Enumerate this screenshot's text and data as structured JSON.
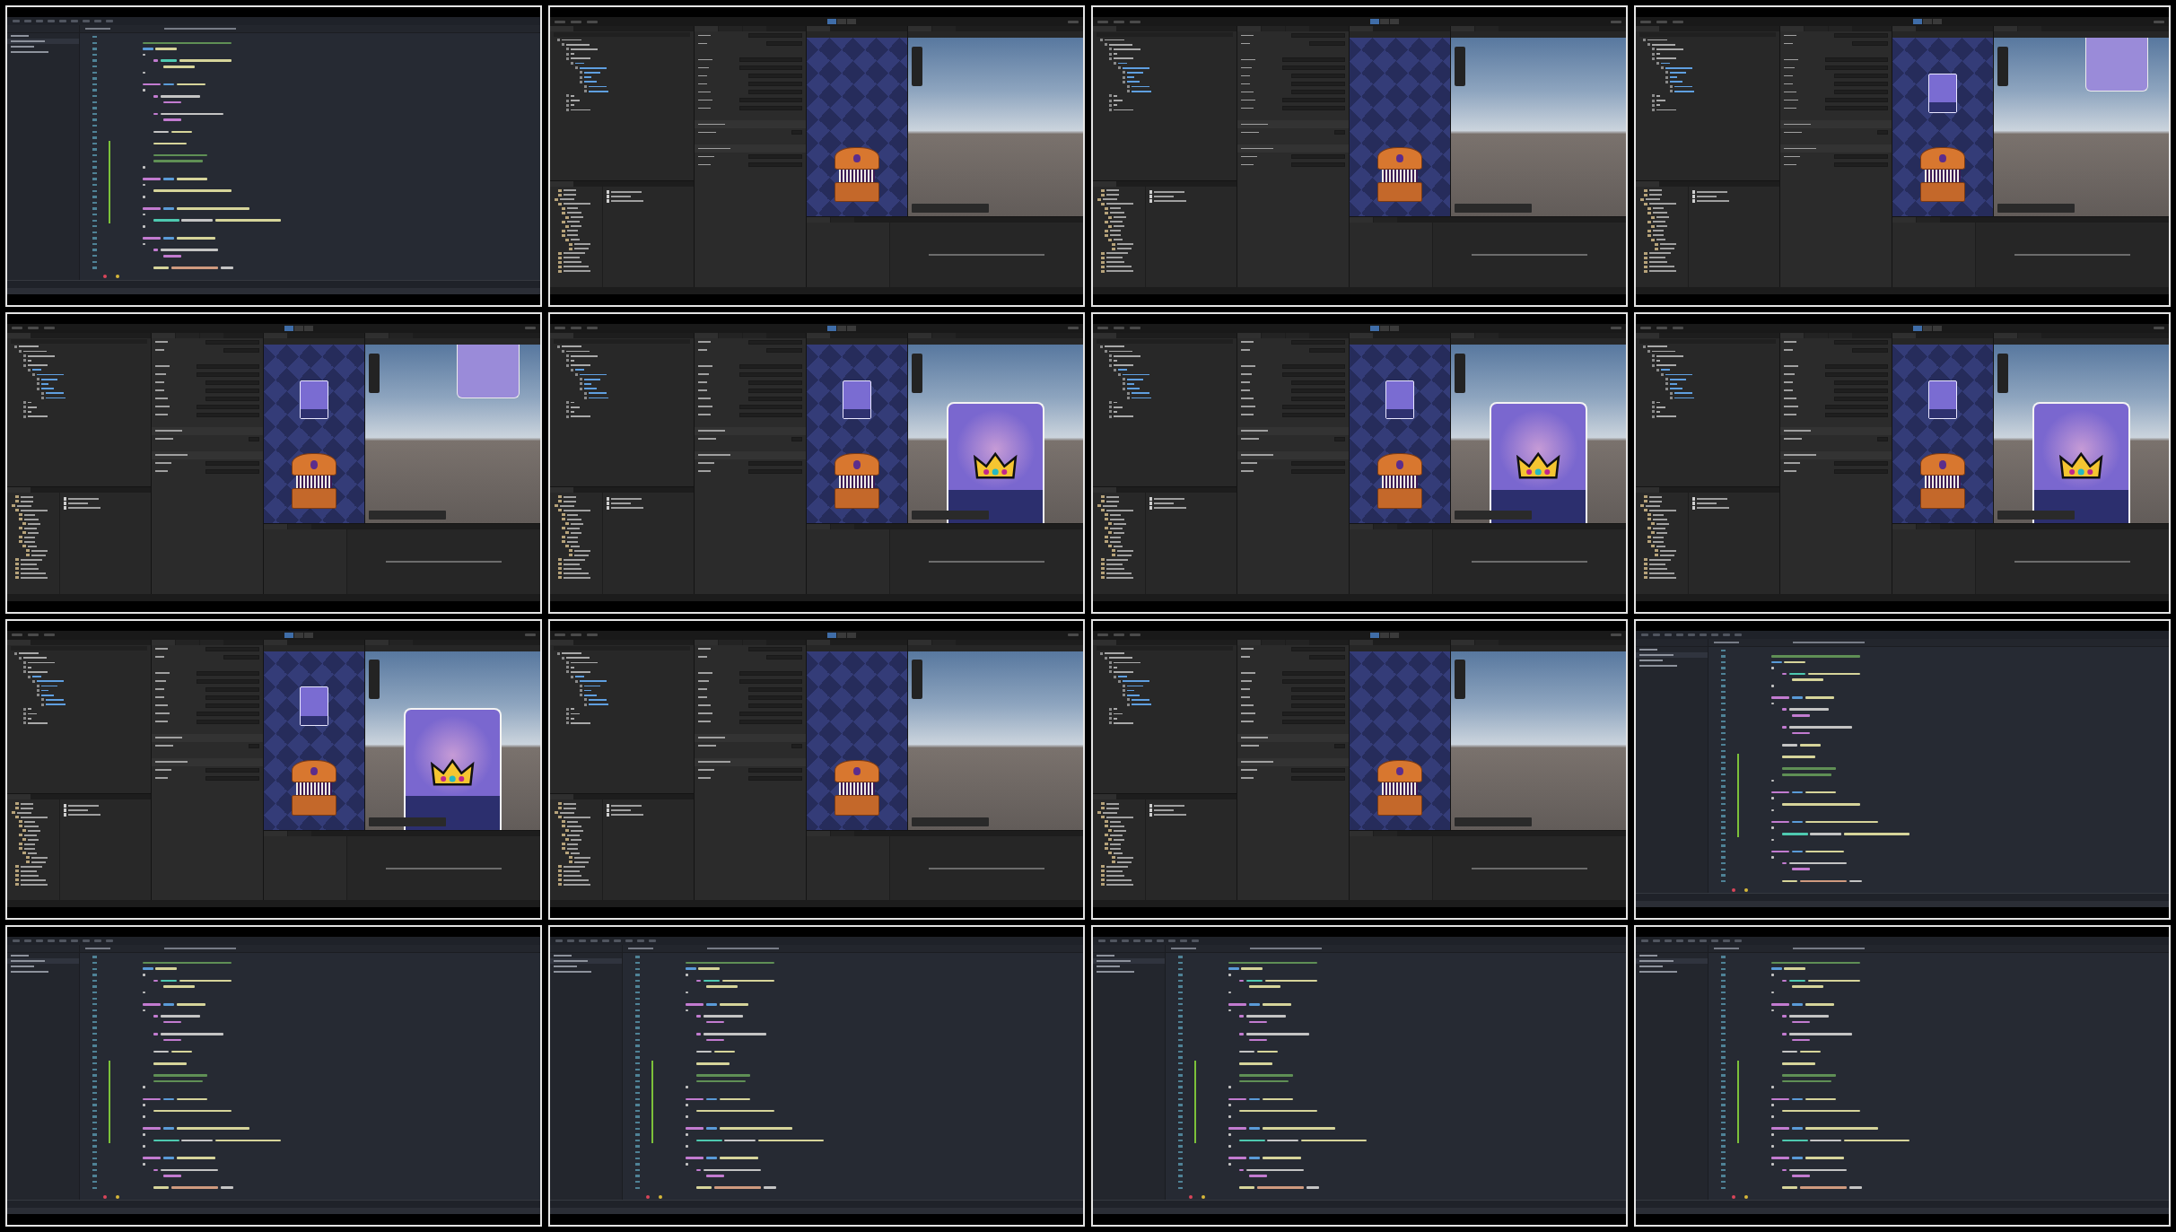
{
  "frames": [
    {
      "kind": "code-editor"
    },
    {
      "kind": "scene-editor",
      "card_in_game_view": false,
      "card_at_scene_top": false,
      "card_fills_scene": false
    },
    {
      "kind": "scene-editor",
      "card_in_game_view": false,
      "card_at_scene_top": false,
      "card_fills_scene": false
    },
    {
      "kind": "scene-editor",
      "card_in_game_view": true,
      "card_at_scene_top": true,
      "card_fills_scene": false
    },
    {
      "kind": "scene-editor",
      "card_in_game_view": true,
      "card_at_scene_top": true,
      "card_fills_scene": false
    },
    {
      "kind": "scene-editor",
      "card_in_game_view": true,
      "card_at_scene_top": false,
      "card_fills_scene": true
    },
    {
      "kind": "scene-editor",
      "card_in_game_view": true,
      "card_at_scene_top": false,
      "card_fills_scene": true
    },
    {
      "kind": "scene-editor",
      "card_in_game_view": true,
      "card_at_scene_top": false,
      "card_fills_scene": true
    },
    {
      "kind": "scene-editor",
      "card_in_game_view": true,
      "card_at_scene_top": false,
      "card_fills_scene": true
    },
    {
      "kind": "scene-editor",
      "card_in_game_view": false,
      "card_at_scene_top": false,
      "card_fills_scene": false
    },
    {
      "kind": "scene-editor",
      "card_in_game_view": false,
      "card_at_scene_top": false,
      "card_fills_scene": false
    },
    {
      "kind": "code-editor"
    },
    {
      "kind": "code-editor"
    },
    {
      "kind": "code-editor"
    },
    {
      "kind": "code-editor"
    },
    {
      "kind": "code-editor"
    }
  ]
}
